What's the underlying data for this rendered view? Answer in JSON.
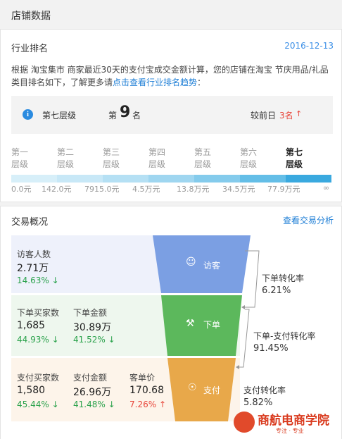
{
  "header": {
    "title": "店铺数据"
  },
  "industry": {
    "title": "行业排名",
    "date": "2016-12-13",
    "desc_text": "根据 淘宝集市 商家最近30天的支付宝成交金额计算，您的店铺在淘宝 节庆用品/礼品类目排名如下，了解更多请",
    "desc_link": "点击查看行业排名趋势",
    "desc_end": "：",
    "tier": "第七层级",
    "rank_prefix": "第",
    "rank_value": "9",
    "rank_suffix": "名",
    "compare_label": "较前日",
    "compare_value": "3名",
    "tiers": [
      {
        "line1": "第一",
        "line2": "层级"
      },
      {
        "line1": "第二",
        "line2": "层级"
      },
      {
        "line1": "第三",
        "line2": "层级"
      },
      {
        "line1": "第四",
        "line2": "层级"
      },
      {
        "line1": "第五",
        "line2": "层级"
      },
      {
        "line1": "第六",
        "line2": "层级"
      },
      {
        "line1": "第七",
        "line2": "层级"
      }
    ],
    "bar_colors": [
      "#d7eff9",
      "#c8e8f7",
      "#b5e0f4",
      "#9fd6f0",
      "#84cbec",
      "#64bee7",
      "#3aa9df"
    ],
    "ticks": [
      "0.0元",
      "142.0元",
      "7915.0元",
      "4.5万元",
      "13.8万元",
      "34.5万元",
      "77.9万元",
      "∞"
    ]
  },
  "transaction": {
    "title": "交易概况",
    "link": "查看交易分析",
    "visitors": {
      "label": "访客人数",
      "value": "2.71万",
      "change": "14.63%"
    },
    "order_buyers": {
      "label": "下单买家数",
      "value": "1,685",
      "change": "44.93%"
    },
    "order_amount": {
      "label": "下单金额",
      "value": "30.89万",
      "change": "41.52%"
    },
    "pay_buyers": {
      "label": "支付买家数",
      "value": "1,580",
      "change": "45.44%"
    },
    "pay_amount": {
      "label": "支付金额",
      "value": "26.96万",
      "change": "41.48%"
    },
    "unit_price": {
      "label": "客单价",
      "value": "170.68",
      "change": "7.26%"
    },
    "funnel": {
      "visit": "访客",
      "order": "下单",
      "pay": "支付"
    },
    "conversions": [
      {
        "label": "下单转化率",
        "value": "6.21%"
      },
      {
        "label": "下单-支付转化率",
        "value": "91.45%"
      },
      {
        "label": "支付转化率",
        "value": "5.82%"
      }
    ],
    "colors": {
      "funnel_top": "#7b9fe3",
      "funnel_mid": "#5cb85c",
      "funnel_bottom": "#e8a84a",
      "up": "#e8463b",
      "down": "#2ba24c"
    }
  },
  "watermark": {
    "name": "商航电商学院",
    "tagline": "专注 · 专业"
  }
}
